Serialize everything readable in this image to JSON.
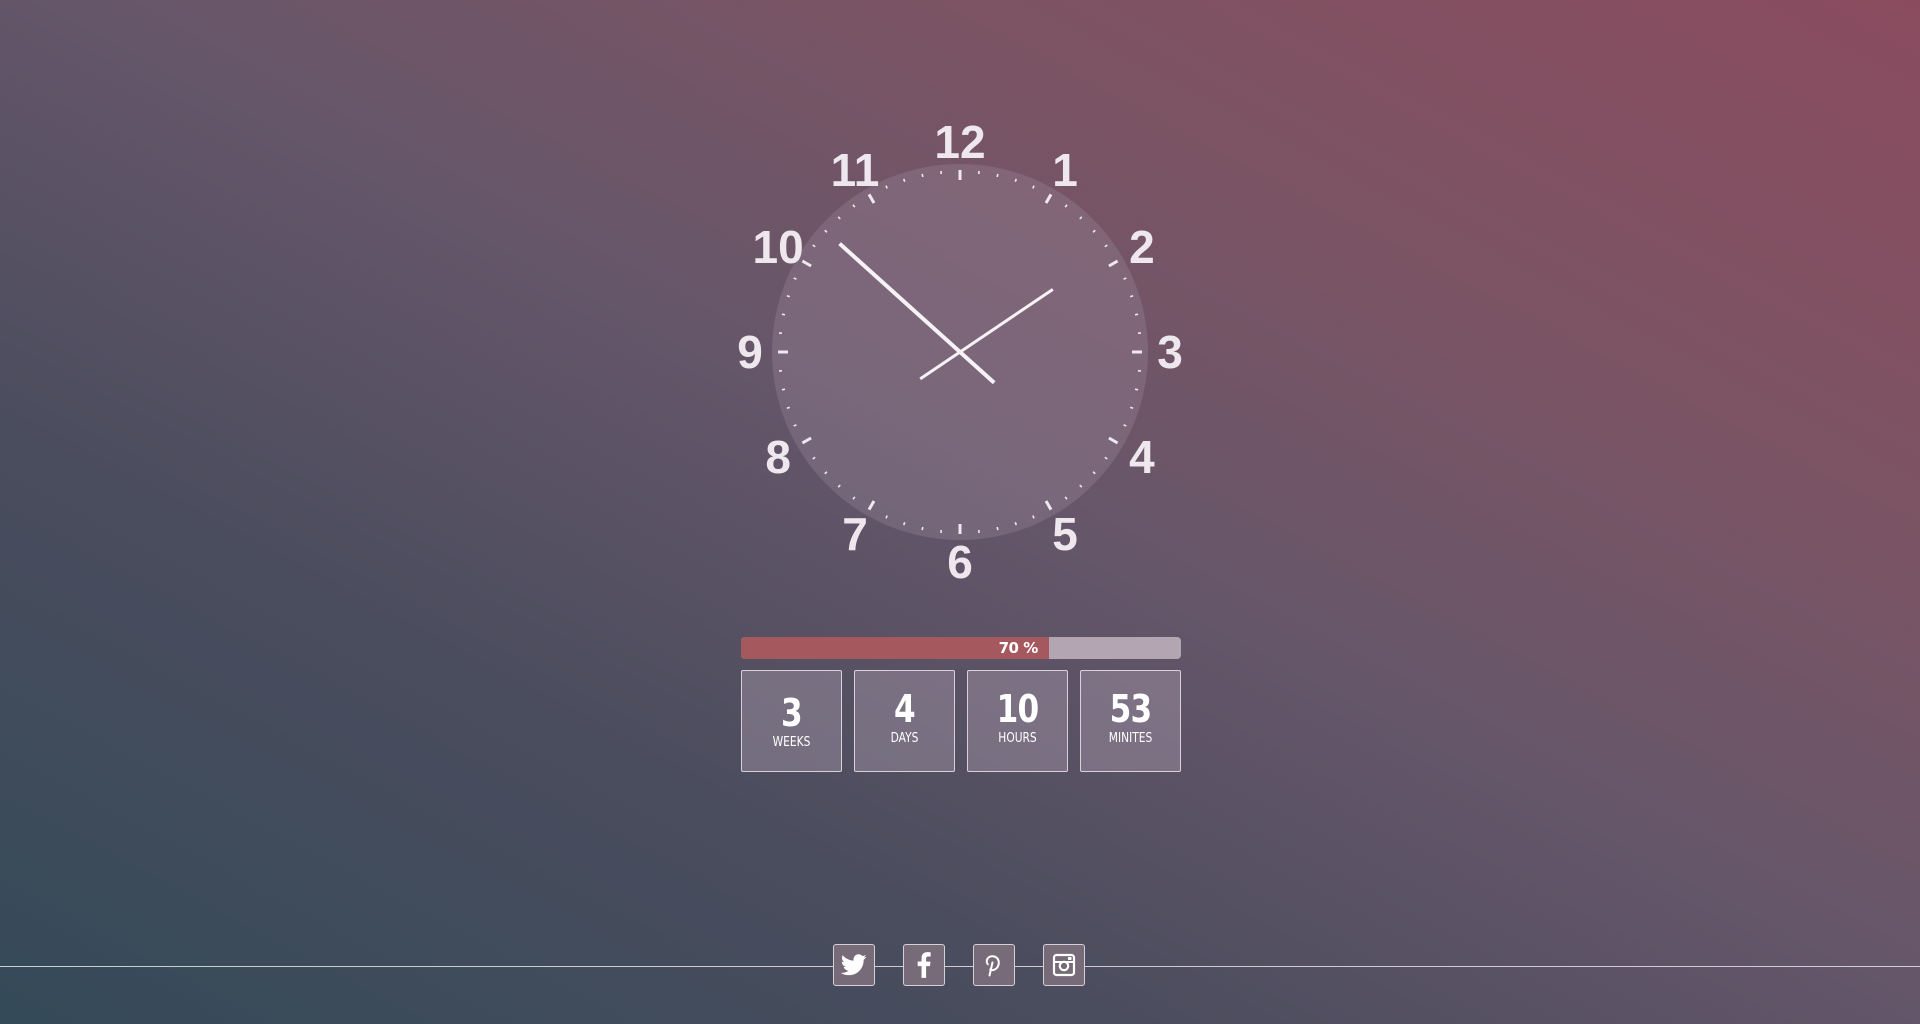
{
  "clock": {
    "numerals": [
      "12",
      "1",
      "2",
      "3",
      "4",
      "5",
      "6",
      "7",
      "8",
      "9",
      "10",
      "11"
    ],
    "time_shown": "1:52"
  },
  "progress": {
    "percent": 70,
    "label": "70 %",
    "fill_color": "#a5595f",
    "track_color": "#b3a5b1"
  },
  "countdown": [
    {
      "value": "3",
      "label": "WEEKS"
    },
    {
      "value": "4",
      "label": "DAYS"
    },
    {
      "value": "10",
      "label": "HOURS"
    },
    {
      "value": "53",
      "label": "MINITES"
    }
  ],
  "social": [
    {
      "icon": "twitter-icon"
    },
    {
      "icon": "facebook-icon"
    },
    {
      "icon": "pinterest-icon"
    },
    {
      "icon": "instagram-icon"
    }
  ]
}
